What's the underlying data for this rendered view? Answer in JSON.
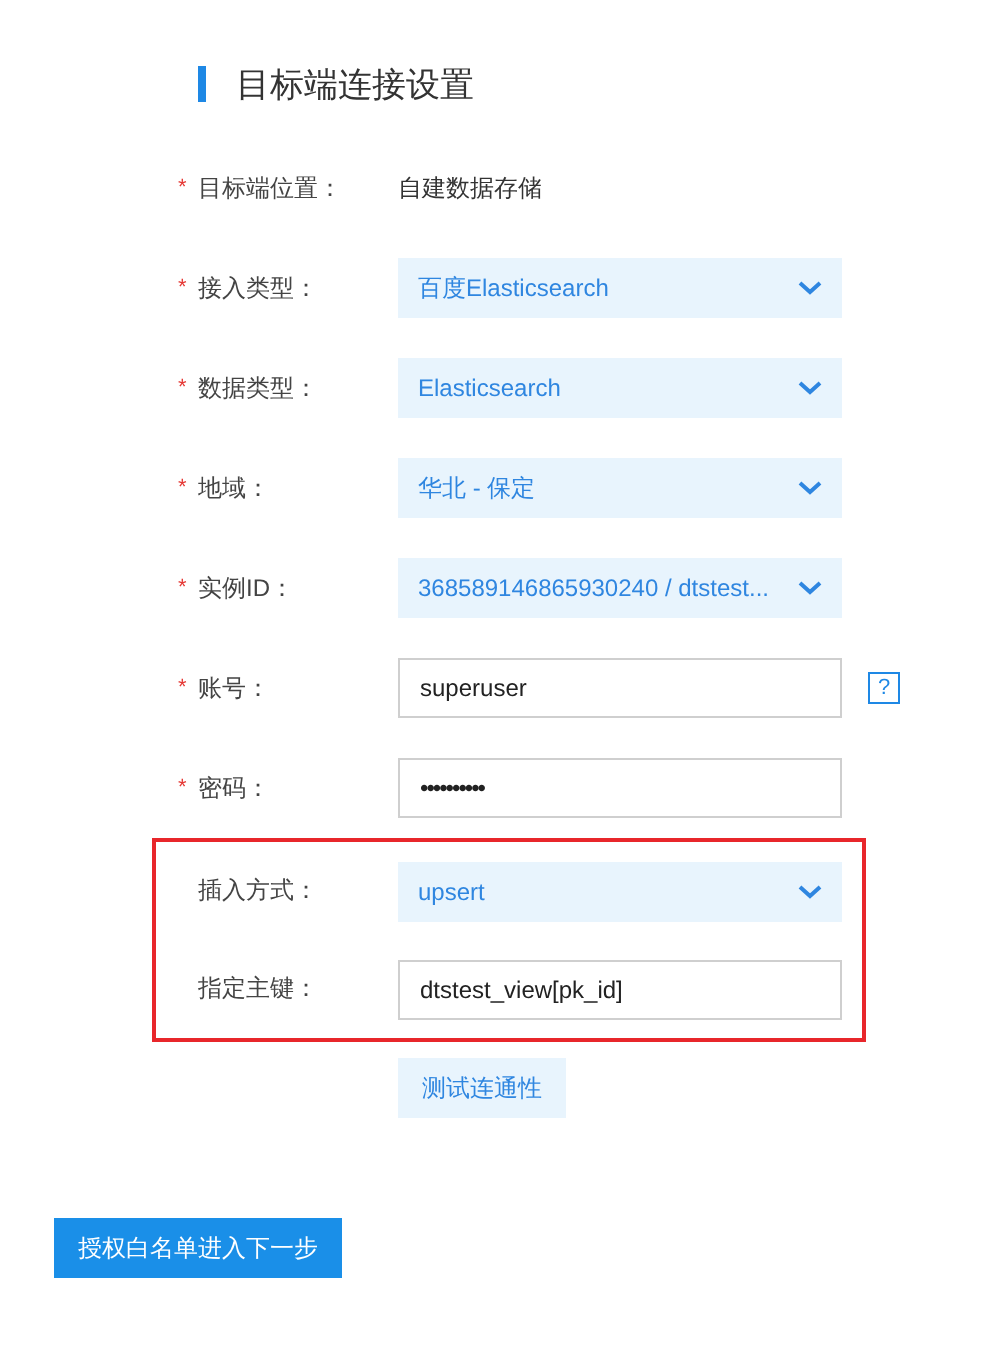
{
  "section_title": "目标端连接设置",
  "fields": [
    {
      "label": "目标端位置：",
      "kind": "text",
      "value": "自建数据存储",
      "required_mark": "*",
      "highlighted": false
    },
    {
      "label": "接入类型：",
      "kind": "select",
      "value": "百度Elasticsearch",
      "required_mark": "*",
      "highlighted": false
    },
    {
      "label": "数据类型：",
      "kind": "select",
      "value": "Elasticsearch",
      "required_mark": "*",
      "highlighted": false
    },
    {
      "label": "地域：",
      "kind": "select",
      "value": "华北 - 保定",
      "required_mark": "*",
      "highlighted": false
    },
    {
      "label": "实例ID：",
      "kind": "select",
      "value": "368589146865930240 / dtstest...",
      "required_mark": "*",
      "highlighted": false
    },
    {
      "label": "账号：",
      "kind": "input",
      "value": "superuser",
      "required_mark": "*",
      "highlighted": false,
      "help": "?"
    },
    {
      "label": "密码：",
      "kind": "password",
      "value": "••••••••••",
      "required_mark": "*",
      "highlighted": false
    },
    {
      "label": "插入方式：",
      "kind": "select",
      "value": "upsert",
      "highlighted": true
    },
    {
      "label": "指定主键：",
      "kind": "input",
      "value": "dtstest_view[pk_id]",
      "highlighted": true
    }
  ],
  "test_button": "测试连通性",
  "next_button": "授权白名单进入下一步"
}
